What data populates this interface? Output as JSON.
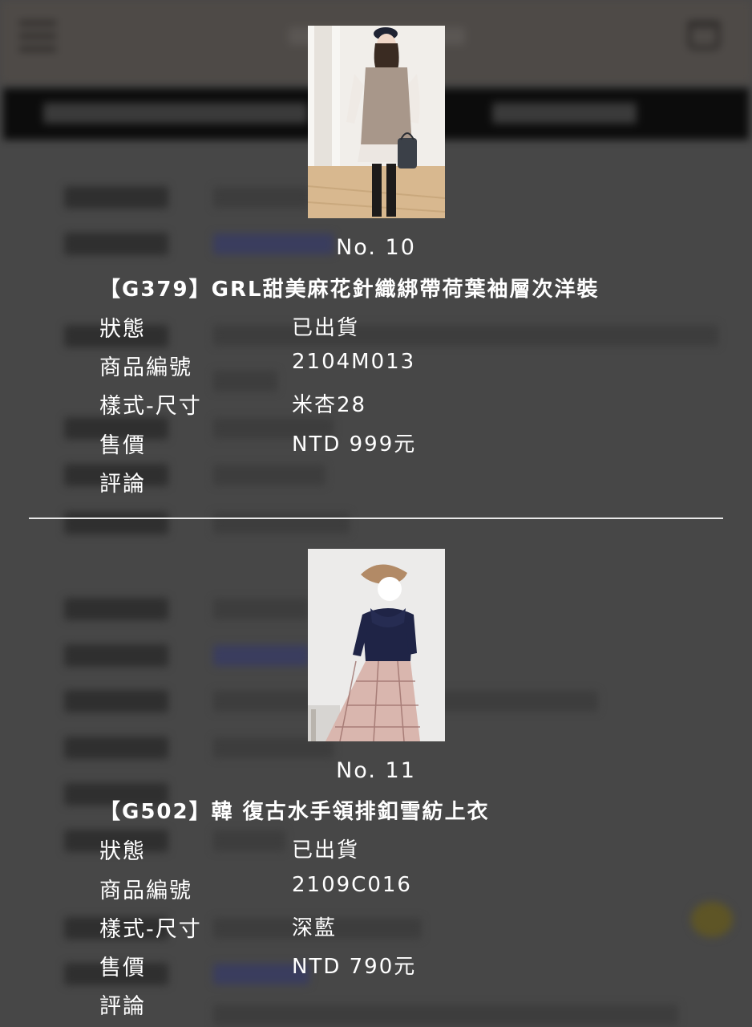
{
  "items": [
    {
      "no": "No. 10",
      "title": "【G379】GRL甜美麻花針織綁帶荷葉袖層次洋裝",
      "fields": [
        {
          "label": "狀態",
          "value": "已出貨"
        },
        {
          "label": "商品編號",
          "value": "2104M013"
        },
        {
          "label": "樣式-尺寸",
          "value": "米杏28"
        },
        {
          "label": "售價",
          "value": "NTD 999元"
        },
        {
          "label": "評論",
          "value": ""
        }
      ],
      "photo_icon": "product-photo-knit-dress"
    },
    {
      "no": "No. 11",
      "title": "【G502】韓 復古水手領排釦雪紡上衣",
      "fields": [
        {
          "label": "狀態",
          "value": "已出貨"
        },
        {
          "label": "商品編號",
          "value": "2109C016"
        },
        {
          "label": "樣式-尺寸",
          "value": "深藍"
        },
        {
          "label": "售價",
          "value": "NTD 790元"
        },
        {
          "label": "評論",
          "value": ""
        }
      ],
      "photo_icon": "product-photo-navy-blouse"
    }
  ],
  "colors": {
    "overlay": "#474747",
    "text": "#ffffff",
    "divider": "#e8e8e8",
    "background_bar": "#0c0c0c",
    "chat_button": "#5e5526"
  }
}
